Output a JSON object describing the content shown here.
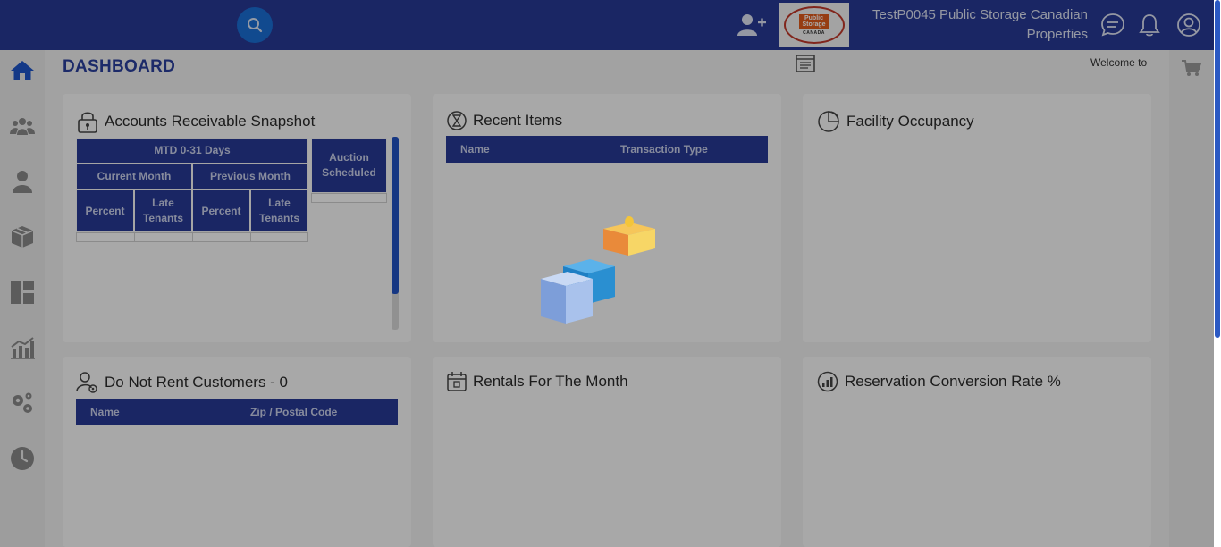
{
  "header": {
    "company_name": "TestP0045 Public Storage Canadian Properties",
    "logo": {
      "line1": "Public",
      "line2": "Storage",
      "sub": "CANADA"
    }
  },
  "icons": {
    "search": "search-icon",
    "add_user": "add-user-icon",
    "chat": "chat-icon",
    "notification": "bell-icon",
    "profile": "user-circle-icon",
    "cart": "cart-icon",
    "notes": "notes-icon"
  },
  "sidebar": {
    "items": [
      {
        "name": "home",
        "icon": "home-icon"
      },
      {
        "name": "customers",
        "icon": "group-icon"
      },
      {
        "name": "user",
        "icon": "user-icon"
      },
      {
        "name": "inventory",
        "icon": "box-icon"
      },
      {
        "name": "layout",
        "icon": "dashboard-layout-icon"
      },
      {
        "name": "reports",
        "icon": "chart-icon"
      },
      {
        "name": "settings",
        "icon": "gears-icon"
      },
      {
        "name": "history",
        "icon": "clock-icon"
      }
    ]
  },
  "page": {
    "title": "DASHBOARD",
    "welcome": "Welcome to"
  },
  "cards": {
    "ar": {
      "title": "Accounts Receivable Snapshot",
      "mtd": "MTD 0-31 Days",
      "current_month": "Current Month",
      "previous_month": "Previous Month",
      "percent": "Percent",
      "late_tenants": "Late Tenants",
      "auction_scheduled": "Auction Scheduled"
    },
    "recent": {
      "title": "Recent Items",
      "columns": [
        "Name",
        "Transaction Type"
      ]
    },
    "occupancy": {
      "title": "Facility Occupancy"
    },
    "dnr": {
      "title": "Do Not Rent Customers - 0",
      "columns": [
        "Name",
        "Zip / Postal Code"
      ]
    },
    "rentals": {
      "title": "Rentals For The Month"
    },
    "reservation": {
      "title": "Reservation Conversion Rate %"
    }
  },
  "colors": {
    "brand": "#283a96",
    "accent": "#1a6fd6",
    "loader_orange": "#e98a3a",
    "loader_blue": "#2a8fd1"
  }
}
